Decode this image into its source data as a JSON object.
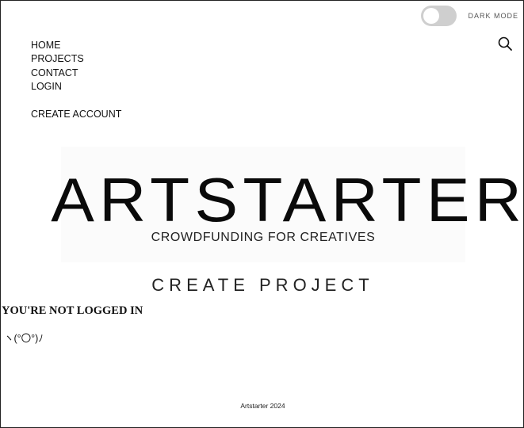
{
  "theme_toggle": {
    "label": "DARK MODE",
    "state": "off"
  },
  "icons": {
    "search": "search-icon"
  },
  "nav": {
    "items": [
      {
        "label": "HOME"
      },
      {
        "label": "PROJECTS"
      },
      {
        "label": "CONTACT"
      },
      {
        "label": "LOGIN"
      }
    ],
    "create_account": "CREATE ACCOUNT"
  },
  "banner": {
    "word": "ARTSTARTER",
    "tagline": "CROWDFUNDING FOR CREATIVES"
  },
  "main": {
    "title": "CREATE PROJECT",
    "not_logged_in": "YOU'RE NOT LOGGED IN",
    "kaomoji": "ヽ(°〇°)ﾉ"
  },
  "footer": {
    "text": "Artstarter 2024"
  }
}
